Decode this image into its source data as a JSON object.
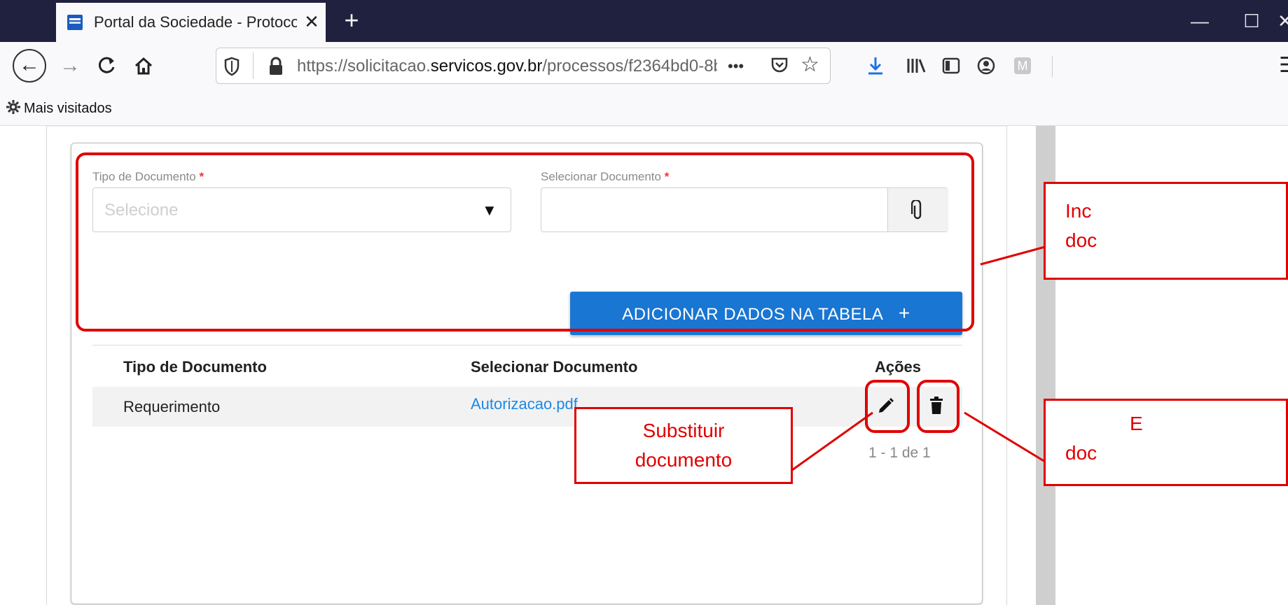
{
  "browser": {
    "tab_title": "Portal da Sociedade - Protocolo",
    "tab_close": "✕",
    "new_tab": "+",
    "window_controls": {
      "minimize": "—",
      "maximize": "☐",
      "close": "✕"
    },
    "url_prefix": "https://solicitacao.",
    "url_domain": "servicos.gov.br",
    "url_path": "/processos/f2364bd0-8b",
    "url_more": "•••",
    "bookmarks_label": "Mais visitados"
  },
  "form": {
    "doc_type_label": "Tipo de Documento",
    "doc_type_placeholder": "Selecione",
    "select_doc_label": "Selecionar Documento",
    "required_marker": "*",
    "add_button_label": "ADICIONAR DADOS NA TABELA",
    "add_button_icon": "+"
  },
  "table": {
    "headers": [
      "Tipo de Documento",
      "Selecionar Documento",
      "Ações"
    ],
    "rows": [
      {
        "doc_type": "Requerimento",
        "file": "Autorizacao.pdf"
      }
    ],
    "pagination": "1 - 1 de 1"
  },
  "annotations": {
    "include_partial": [
      "Inc",
      "doc"
    ],
    "replace": [
      "Substituir",
      "documento"
    ],
    "delete_partial": [
      "E",
      "doc"
    ]
  },
  "colors": {
    "accent": "#1976d2",
    "annotation": "#e00000",
    "titlebar": "#20213f",
    "link": "#1e88e5",
    "required": "#e53935"
  }
}
